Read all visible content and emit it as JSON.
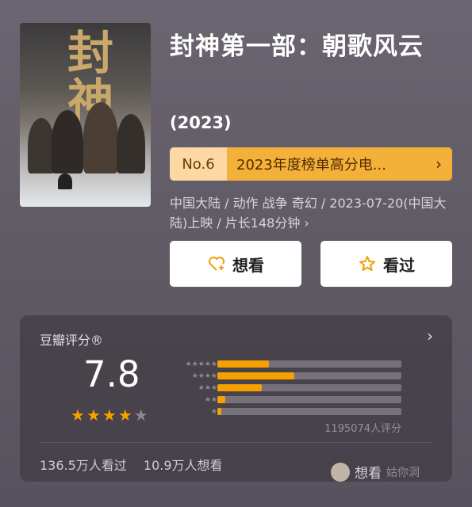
{
  "movie": {
    "title": "封神第一部：朝歌风云",
    "year": "(2023)",
    "poster_title": "封神",
    "meta": "中国大陆 / 动作 战争 奇幻 / 2023-07-20(中国大陆)上映 / 片长148分钟 ›"
  },
  "ranking": {
    "no": "No.6",
    "text": "2023年度榜单高分电...",
    "chevron": "›"
  },
  "actions": {
    "want_label": "想看",
    "seen_label": "看过"
  },
  "rating": {
    "title": "豆瓣评分®",
    "score": "7.8",
    "stars_filled": 4,
    "stars_total": 5,
    "distribution": [
      {
        "stars": 5,
        "label": "★★★★★",
        "fraction": 0.28
      },
      {
        "stars": 4,
        "label": "★★★★",
        "fraction": 0.42
      },
      {
        "stars": 3,
        "label": "★★★",
        "fraction": 0.24
      },
      {
        "stars": 2,
        "label": "★★",
        "fraction": 0.045
      },
      {
        "stars": 1,
        "label": "★",
        "fraction": 0.02
      }
    ],
    "votes": "1195074人评分",
    "seen": "136.5万人看过",
    "want": "10.9万人想看",
    "chevron": "›"
  },
  "watermark": {
    "text": "想看",
    "sub": "姑你洞"
  },
  "colors": {
    "accent": "#f7a000",
    "rank_light": "#fcd9a4",
    "rank_dark": "#f4b13a"
  },
  "icons": {
    "want": "heart-plus-icon",
    "seen": "star-outline-icon"
  }
}
